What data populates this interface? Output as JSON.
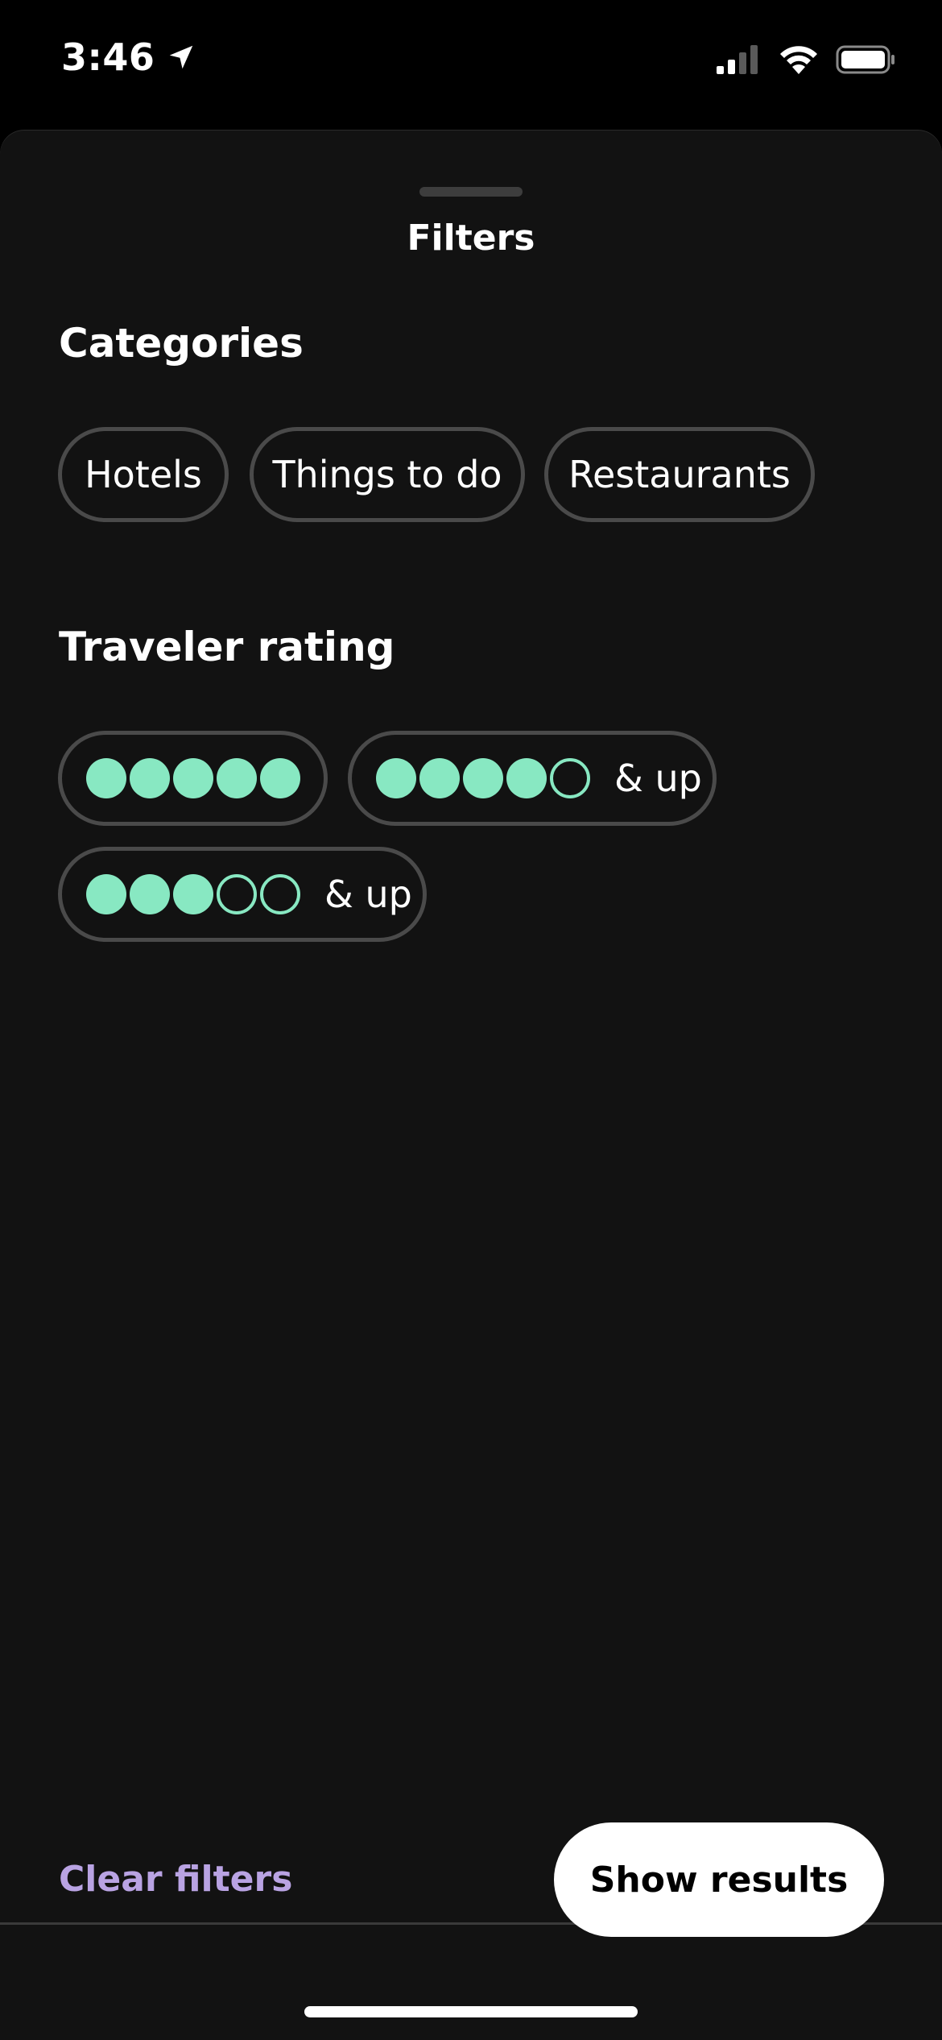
{
  "status_bar": {
    "time": "3:46"
  },
  "sheet": {
    "title": "Filters"
  },
  "categories": {
    "title": "Categories",
    "items": [
      "Hotels",
      "Things to do",
      "Restaurants"
    ]
  },
  "traveler_rating": {
    "title": "Traveler rating",
    "options": [
      {
        "filled": 5,
        "total": 5,
        "suffix": ""
      },
      {
        "filled": 4,
        "total": 5,
        "suffix": "& up"
      },
      {
        "filled": 3,
        "total": 5,
        "suffix": "& up"
      }
    ]
  },
  "footer": {
    "clear_label": "Clear filters",
    "show_label": "Show results"
  },
  "colors": {
    "bubble": "#88e8c2",
    "clear_link": "#b9a3e3",
    "sheet_bg": "#121212"
  },
  "icons": {
    "location": "location-arrow-icon",
    "signal": "cellular-signal-icon",
    "wifi": "wifi-icon",
    "battery": "battery-icon"
  }
}
